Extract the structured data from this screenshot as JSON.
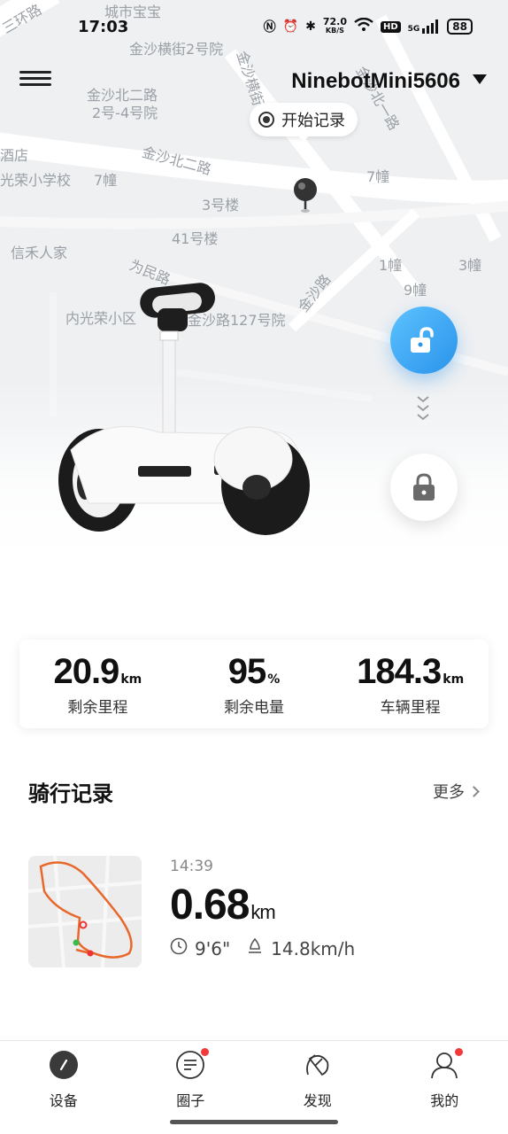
{
  "status_bar": {
    "time": "17:03",
    "net_speed": "72.0",
    "net_unit": "KB/S",
    "signal_type": "5G",
    "battery": "88",
    "icons": [
      "nfc-icon",
      "alarm-icon",
      "bluetooth-icon",
      "wifi-icon",
      "hd-icon",
      "signal-icon",
      "battery-icon"
    ]
  },
  "header": {
    "device_name": "NinebotMini5606",
    "record_label": "开始记录"
  },
  "map": {
    "labels": [
      "城市宝宝",
      "金沙横街2号院",
      "金沙北二路",
      "2号-4号院",
      "金沙北二路",
      "7幢",
      "3号楼",
      "41号楼",
      "信禾人家",
      "为民路",
      "内光荣小区",
      "金沙路127号院",
      "金沙路",
      "光荣小学校",
      "酒店",
      "1幢",
      "3幢",
      "9幢",
      "7幢",
      "金沙北一路",
      "金沙横街",
      "三环路"
    ]
  },
  "controls": {
    "unlock": "unlock-icon",
    "lock": "lock-icon"
  },
  "stats": [
    {
      "value": "20.9",
      "unit": "km",
      "label": "剩余里程"
    },
    {
      "value": "95",
      "unit": "%",
      "label": "剩余电量"
    },
    {
      "value": "184.3",
      "unit": "km",
      "label": "车辆里程"
    }
  ],
  "rides": {
    "title": "骑行记录",
    "more": "更多",
    "items": [
      {
        "time": "14:39",
        "distance": "0.68",
        "unit": "km",
        "duration": "9'6\"",
        "speed": "14.8km/h"
      }
    ]
  },
  "nav": [
    {
      "label": "设备",
      "icon": "device-icon",
      "badge": false
    },
    {
      "label": "圈子",
      "icon": "circle-icon",
      "badge": true
    },
    {
      "label": "发现",
      "icon": "discover-icon",
      "badge": false
    },
    {
      "label": "我的",
      "icon": "profile-icon",
      "badge": true
    }
  ],
  "colors": {
    "accent": "#2a93ea",
    "badge": "#f23a3a",
    "route": "#e8682c"
  }
}
